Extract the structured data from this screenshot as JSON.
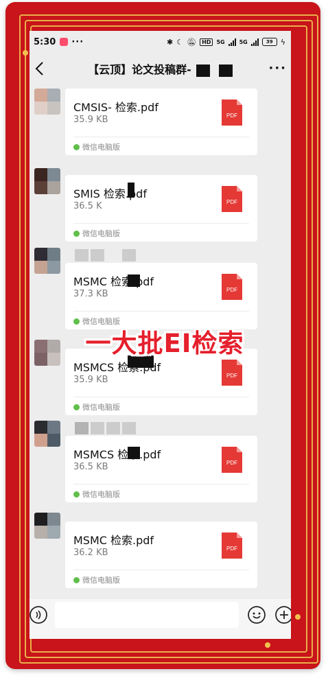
{
  "status_bar": {
    "time": "5:30",
    "more": "···",
    "hd_badge": "HD",
    "network_1": "5G",
    "network_2": "5G",
    "battery": "39"
  },
  "nav": {
    "title": "【云顶】论文投稿群-",
    "more": "···"
  },
  "messages": [
    {
      "file_name": "CMSIS-          检索.pdf",
      "size": "35.9 KB",
      "source": "微信电脑版"
    },
    {
      "file_name": "SMIS        检索.pdf",
      "size": "36.5 K",
      "source": "微信电脑版"
    },
    {
      "file_name": "MSMC          检索.pdf",
      "size": "37.3 KB",
      "source": "微信电脑版"
    },
    {
      "file_name": "MSMCS          检索.pdf",
      "size": "35.9 KB",
      "source": "微信电脑版"
    },
    {
      "file_name": "MSMCS          检索.pdf",
      "size": "36.5 KB",
      "source": "微信电脑版"
    },
    {
      "file_name": "MSMC           检索.pdf",
      "size": "36.2 KB",
      "source": "微信电脑版"
    }
  ],
  "pdf_label": "PDF",
  "overlay": "一大批EI检索",
  "colors": {
    "frame_red": "#c8141a",
    "frame_gold": "#e9b04a",
    "pdf_red": "#e53935",
    "overlay_red": "#e51f2c"
  }
}
